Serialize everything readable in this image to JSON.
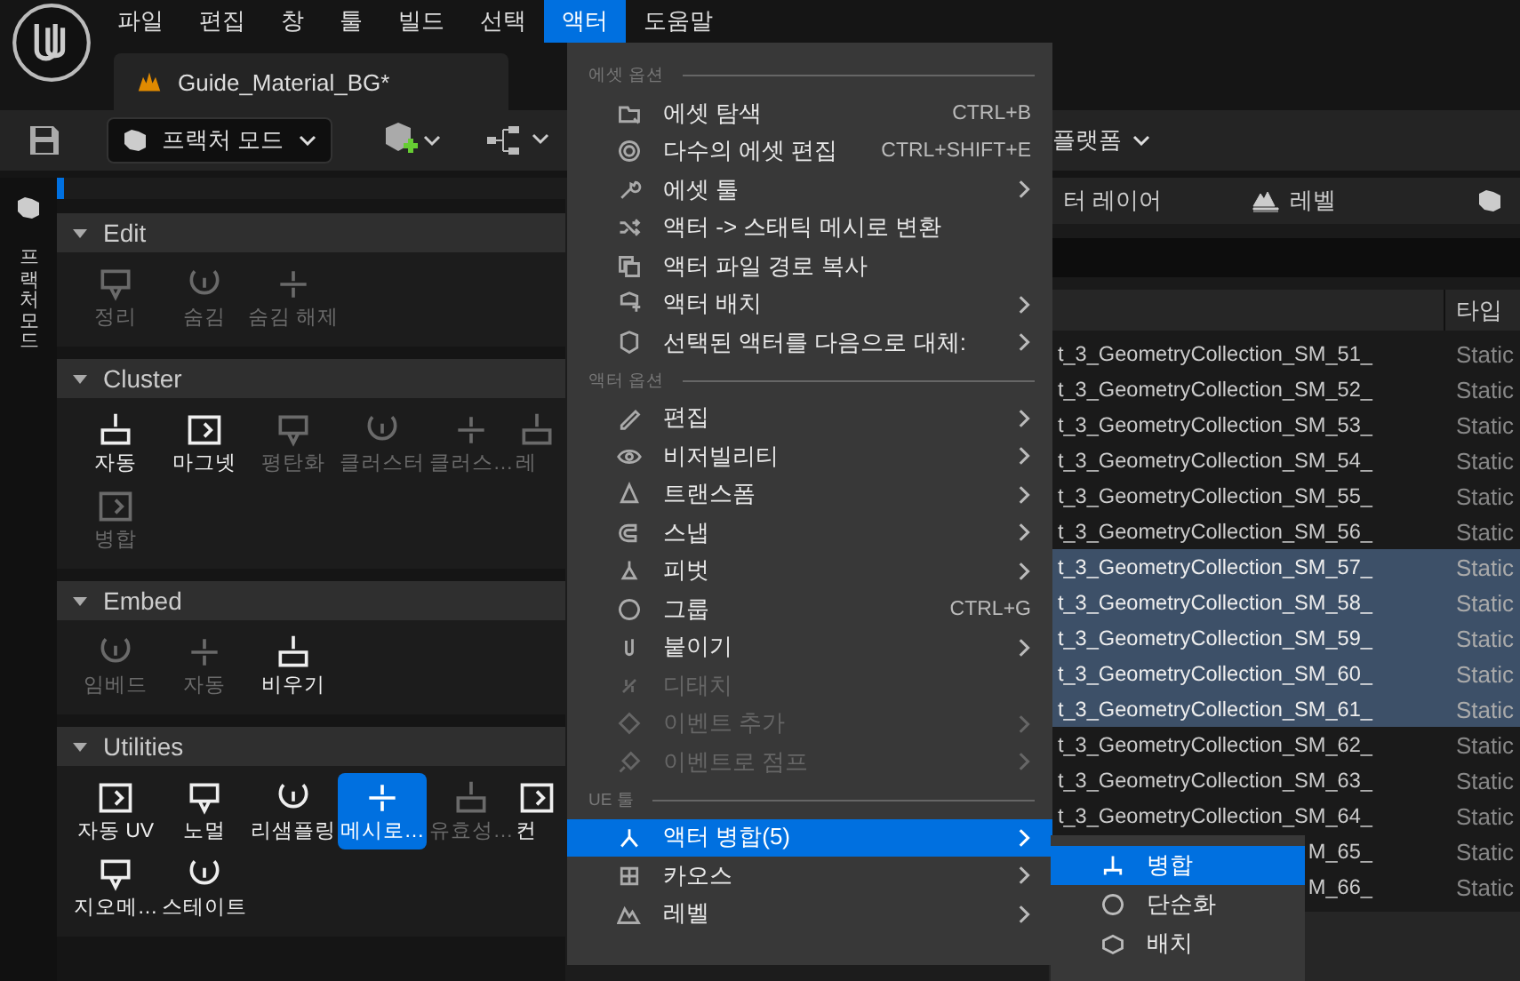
{
  "menubar": [
    {
      "label": "파일",
      "selected": false
    },
    {
      "label": "편집",
      "selected": false
    },
    {
      "label": "창",
      "selected": false
    },
    {
      "label": "툴",
      "selected": false
    },
    {
      "label": "빌드",
      "selected": false
    },
    {
      "label": "선택",
      "selected": false
    },
    {
      "label": "액터",
      "selected": true
    },
    {
      "label": "도움말",
      "selected": false
    }
  ],
  "document_tab": {
    "title": "Guide_Material_BG*"
  },
  "toolbar": {
    "mode_dropdown": {
      "label": "프랙처 모드"
    },
    "platforms": {
      "label": "플랫폼"
    }
  },
  "side_tab": {
    "label": "프랙처 모드"
  },
  "tool_sections": [
    {
      "title": "Edit",
      "expanded": true,
      "tools": [
        {
          "label": "정리",
          "disabled": true,
          "selected": false
        },
        {
          "label": "숨김",
          "disabled": true,
          "selected": false
        },
        {
          "label": "숨김 해제",
          "disabled": true,
          "selected": false
        }
      ]
    },
    {
      "title": "Cluster",
      "expanded": true,
      "tools": [
        {
          "label": "자동",
          "disabled": false,
          "selected": false
        },
        {
          "label": "마그넷",
          "disabled": false,
          "selected": false
        },
        {
          "label": "평탄화",
          "disabled": true,
          "selected": false
        },
        {
          "label": "클러스터",
          "disabled": true,
          "selected": false
        },
        {
          "label": "클러스…",
          "disabled": true,
          "selected": false
        },
        {
          "label": "레",
          "disabled": true,
          "selected": false
        },
        {
          "label": "병합",
          "disabled": true,
          "selected": false
        }
      ]
    },
    {
      "title": "Embed",
      "expanded": true,
      "tools": [
        {
          "label": "임베드",
          "disabled": true,
          "selected": false
        },
        {
          "label": "자동",
          "disabled": true,
          "selected": false
        },
        {
          "label": "비우기",
          "disabled": false,
          "selected": false
        }
      ]
    },
    {
      "title": "Utilities",
      "expanded": true,
      "tools": [
        {
          "label": "자동 UV",
          "disabled": false,
          "selected": false
        },
        {
          "label": "노멀",
          "disabled": false,
          "selected": false
        },
        {
          "label": "리샘플링",
          "disabled": false,
          "selected": false
        },
        {
          "label": "메시로…",
          "disabled": false,
          "selected": true
        },
        {
          "label": "유효성…",
          "disabled": true,
          "selected": false
        },
        {
          "label": "컨",
          "disabled": false,
          "selected": false
        },
        {
          "label": "지오메…",
          "disabled": false,
          "selected": false
        },
        {
          "label": "스테이트",
          "disabled": false,
          "selected": false
        }
      ]
    }
  ],
  "outliner": {
    "tabs": [
      {
        "label": "터 레이어"
      },
      {
        "label": "레벨"
      }
    ],
    "type_column": "타입",
    "rows": [
      {
        "name": "t_3_GeometryCollection_SM_51_",
        "type": "Static",
        "selected": false
      },
      {
        "name": "t_3_GeometryCollection_SM_52_",
        "type": "Static",
        "selected": false
      },
      {
        "name": "t_3_GeometryCollection_SM_53_",
        "type": "Static",
        "selected": false
      },
      {
        "name": "t_3_GeometryCollection_SM_54_",
        "type": "Static",
        "selected": false
      },
      {
        "name": "t_3_GeometryCollection_SM_55_",
        "type": "Static",
        "selected": false
      },
      {
        "name": "t_3_GeometryCollection_SM_56_",
        "type": "Static",
        "selected": false
      },
      {
        "name": "t_3_GeometryCollection_SM_57_",
        "type": "Static",
        "selected": true
      },
      {
        "name": "t_3_GeometryCollection_SM_58_",
        "type": "Static",
        "selected": true
      },
      {
        "name": "t_3_GeometryCollection_SM_59_",
        "type": "Static",
        "selected": true
      },
      {
        "name": "t_3_GeometryCollection_SM_60_",
        "type": "Static",
        "selected": true
      },
      {
        "name": "t_3_GeometryCollection_SM_61_",
        "type": "Static",
        "selected": true
      },
      {
        "name": "t_3_GeometryCollection_SM_62_",
        "type": "Static",
        "selected": false
      },
      {
        "name": "t_3_GeometryCollection_SM_63_",
        "type": "Static",
        "selected": false
      },
      {
        "name": "t_3_GeometryCollection_SM_64_",
        "type": "Static",
        "selected": false
      },
      {
        "name": "M_65_",
        "type": "Static",
        "selected": false
      },
      {
        "name": "M_66_",
        "type": "Static",
        "selected": false
      }
    ]
  },
  "actor_menu": {
    "sections": [
      {
        "title": "에셋 옵션",
        "items": [
          {
            "label": "에셋 탐색",
            "shortcut": "CTRL+B",
            "submenu": false,
            "disabled": false,
            "selected": false
          },
          {
            "label": "다수의 에셋 편집",
            "shortcut": "CTRL+SHIFT+E",
            "submenu": false,
            "disabled": false,
            "selected": false
          },
          {
            "label": "에셋 툴",
            "submenu": true,
            "disabled": false,
            "selected": false
          },
          {
            "label": "액터 -> 스태틱 메시로 변환",
            "submenu": false,
            "disabled": false,
            "selected": false
          },
          {
            "label": "액터 파일 경로 복사",
            "submenu": false,
            "disabled": false,
            "selected": false
          },
          {
            "label": "액터 배치",
            "submenu": true,
            "disabled": false,
            "selected": false
          },
          {
            "label": "선택된 액터를 다음으로 대체:",
            "submenu": true,
            "disabled": false,
            "selected": false
          }
        ]
      },
      {
        "title": "액터 옵션",
        "items": [
          {
            "label": "편집",
            "submenu": true,
            "disabled": false,
            "selected": false
          },
          {
            "label": "비저빌리티",
            "submenu": true,
            "disabled": false,
            "selected": false
          },
          {
            "label": "트랜스폼",
            "submenu": true,
            "disabled": false,
            "selected": false
          },
          {
            "label": "스냅",
            "submenu": true,
            "disabled": false,
            "selected": false
          },
          {
            "label": "피벗",
            "submenu": true,
            "disabled": false,
            "selected": false
          },
          {
            "label": "그룹",
            "shortcut": "CTRL+G",
            "submenu": false,
            "disabled": false,
            "selected": false
          },
          {
            "label": "붙이기",
            "submenu": true,
            "disabled": false,
            "selected": false
          },
          {
            "label": "디태치",
            "submenu": false,
            "disabled": true,
            "selected": false
          },
          {
            "label": "이벤트 추가",
            "submenu": true,
            "disabled": true,
            "selected": false
          },
          {
            "label": "이벤트로 점프",
            "submenu": true,
            "disabled": true,
            "selected": false
          }
        ]
      },
      {
        "title": "UE 툴",
        "items": [
          {
            "label": "액터 병합(5)",
            "submenu": true,
            "disabled": false,
            "selected": true
          },
          {
            "label": "카오스",
            "submenu": true,
            "disabled": false,
            "selected": false
          },
          {
            "label": "레벨",
            "submenu": true,
            "disabled": false,
            "selected": false
          }
        ]
      }
    ]
  },
  "merge_submenu": {
    "items": [
      {
        "label": "병합",
        "selected": true
      },
      {
        "label": "단순화",
        "selected": false
      },
      {
        "label": "배치",
        "selected": false
      }
    ]
  }
}
